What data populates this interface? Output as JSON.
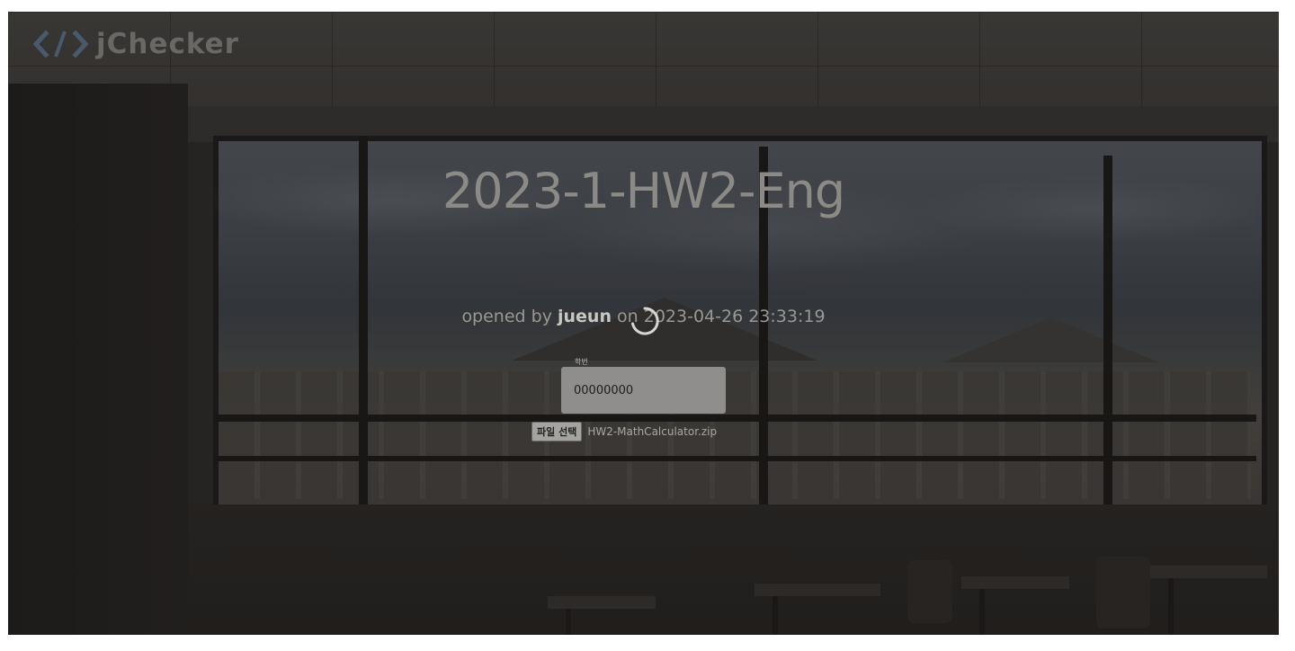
{
  "app": {
    "logo_text": "jChecker",
    "logo_icon": "code-brackets-icon"
  },
  "assignment": {
    "title": "2023-1-HW2-Eng",
    "opened_prefix": "opened by",
    "author": "jueun",
    "opened_on_word": "on",
    "opened_at": "2023-04-26 23:33:19"
  },
  "form": {
    "id_label": "학번",
    "id_value": "00000000",
    "file_button_label": "파일 선택",
    "file_name": "HW2-MathCalculator.zip"
  },
  "status": {
    "loading_icon": "spinner-icon"
  }
}
